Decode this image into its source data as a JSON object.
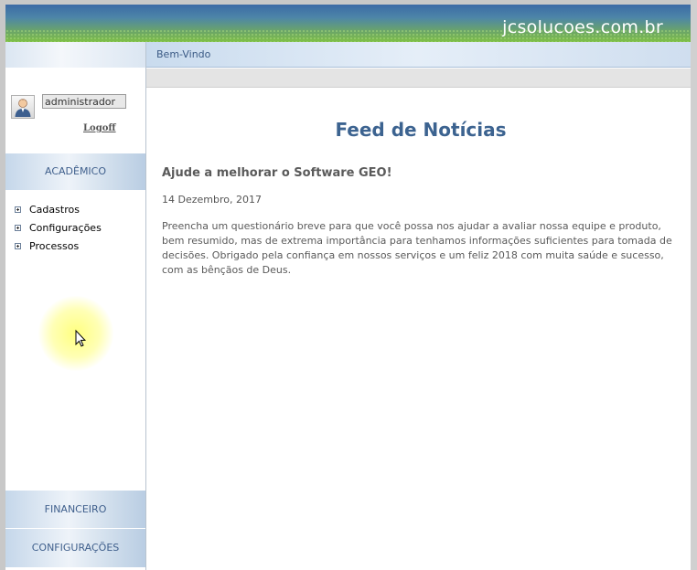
{
  "header": {
    "site_name": "jcsolucoes.com.br"
  },
  "sidebar": {
    "user": {
      "username": "administrador",
      "logoff_label": "Logoff"
    },
    "sections": {
      "academico": "ACADÊMICO",
      "financeiro": "FINANCEIRO",
      "configuracoes": "CONFIGURAÇÕES"
    },
    "menu_items": [
      {
        "label": "Cadastros"
      },
      {
        "label": "Configurações"
      },
      {
        "label": "Processos"
      }
    ]
  },
  "main": {
    "tab_label": "Bem-Vindo",
    "feed_title": "Feed de Notícias",
    "article": {
      "title": "Ajude a melhorar o Software GEO!",
      "date": "14 Dezembro, 2017",
      "body": "Preencha um questionário breve para que você possa nos ajudar a avaliar nossa equipe e produto, bem resumido, mas de extrema importância para tenhamos informações suficientes para tomada de decisões. Obrigado pela confiança em nossos serviços e um feliz 2018 com muita saúde e sucesso, com as bênçãos de Deus."
    }
  },
  "colors": {
    "header_gradient_top": "#3b6aa5",
    "header_gradient_bottom": "#7fbf47",
    "section_text": "#3f5f8c",
    "feed_title": "#3c6390"
  },
  "icons": [
    "user-avatar-icon",
    "plus-expand-icon",
    "mouse-cursor-icon"
  ]
}
